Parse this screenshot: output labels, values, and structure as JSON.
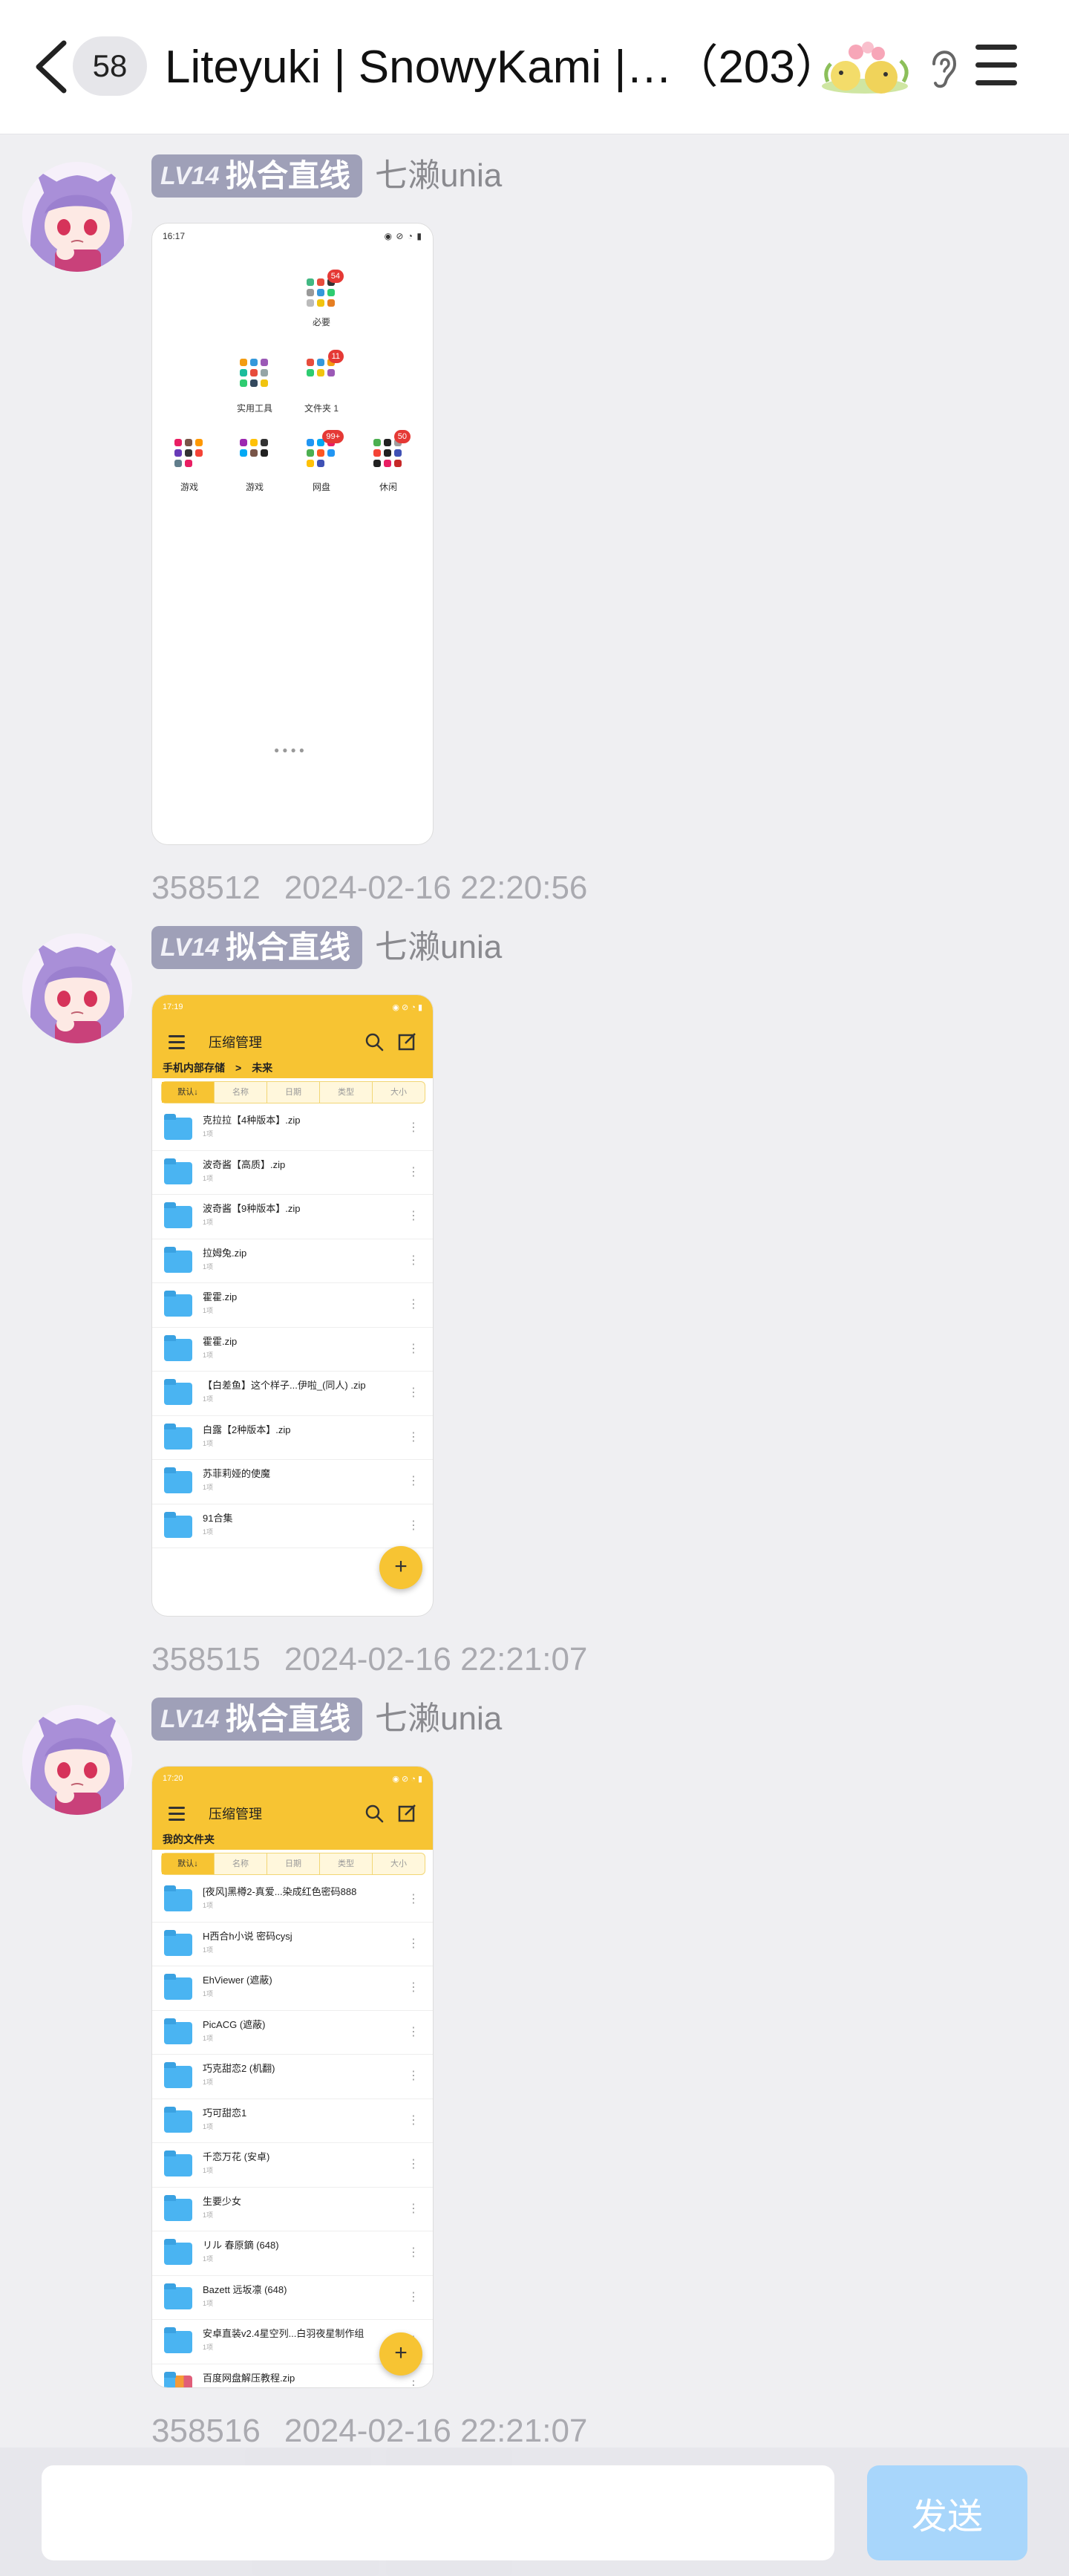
{
  "header": {
    "unread_count": "58",
    "title": "Liteyuki | SnowyKami |…（203）"
  },
  "messages": [
    {
      "level": "LV14",
      "rank": "拟合直线",
      "sender": "七濑unia",
      "msg_id": "358512",
      "timestamp": "2024-02-16 22:20:56",
      "screenshot": {
        "status_time": "16:17",
        "folders": [
          {
            "label": "必要",
            "badge": "54"
          },
          {
            "label": "实用工具",
            "badge": ""
          },
          {
            "label": "文件夹 1",
            "badge": "11"
          },
          {
            "label": "游戏",
            "badge": ""
          },
          {
            "label": "游戏",
            "badge": ""
          },
          {
            "label": "网盘",
            "badge": "99+"
          },
          {
            "label": "休闲",
            "badge": "50"
          }
        ]
      }
    },
    {
      "level": "LV14",
      "rank": "拟合直线",
      "sender": "七濑unia",
      "msg_id": "358515",
      "timestamp": "2024-02-16 22:21:07",
      "screenshot": {
        "status_time": "17:19",
        "app_title": "压缩管理",
        "path": [
          "手机内部存储",
          "未来"
        ],
        "sort_tabs": [
          "默认↓",
          "名称",
          "日期",
          "类型",
          "大小"
        ],
        "files": [
          "克拉拉【4种版本】.zip",
          "波奇酱【高质】.zip",
          "波奇酱【9种版本】.zip",
          "拉姆兔.zip",
          "霍霍.zip",
          "霍霍.zip",
          "【白差鱼】这个样子...伊啦_(同人) .zip",
          "白露【2种版本】.zip",
          "苏菲莉娅的使魔",
          "91合集"
        ],
        "file_sub": "1项"
      }
    },
    {
      "level": "LV14",
      "rank": "拟合直线",
      "sender": "七濑unia",
      "msg_id": "358516",
      "timestamp": "2024-02-16 22:21:07",
      "screenshot": {
        "status_time": "17:20",
        "app_title": "压缩管理",
        "path": [
          "我的文件夹"
        ],
        "sort_tabs": [
          "默认↓",
          "名称",
          "日期",
          "类型",
          "大小"
        ],
        "files": [
          "[夜风]黑樽2-真爱...染成红色密码888",
          "H西合h小说 密码cysj",
          "EhViewer (遮蔽)",
          "PicACG (遮蔽)",
          "巧克甜恋2 (机翻)",
          "巧可甜恋1",
          "千恋万花 (安卓)",
          "生要少女",
          "リル 春原鏑 (648)",
          "Bazett 远坂凛 (648)",
          "安卓直装v2.4星空列...白羽夜星制作组",
          "百度网盘解压教程.zip"
        ],
        "file_sub": "1项"
      }
    }
  ],
  "composer": {
    "input_value": "",
    "send_label": "发送"
  },
  "colors": {
    "header_bg": "#ffffff",
    "page_bg": "#efeff2",
    "level_badge": "#9fa0b8",
    "send_button": "#a8d6fb",
    "file_manager_bar": "#f7c433",
    "folder_blue": "#4ab4f2"
  }
}
